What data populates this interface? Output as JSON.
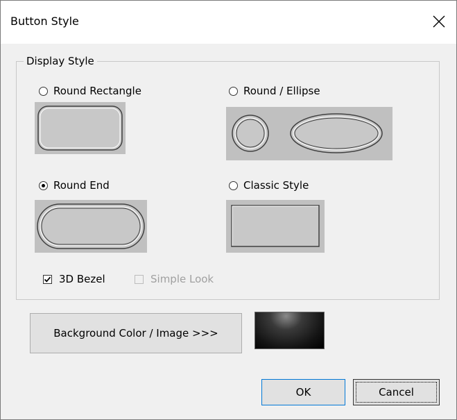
{
  "dialog": {
    "title": "Button Style"
  },
  "group": {
    "label": "Display Style"
  },
  "styles": [
    {
      "label": "Round Rectangle",
      "selected": false
    },
    {
      "label": "Round / Ellipse",
      "selected": false
    },
    {
      "label": "Round End",
      "selected": true
    },
    {
      "label": "Classic Style",
      "selected": false
    }
  ],
  "options": {
    "bezel": {
      "label": "3D Bezel",
      "checked": true,
      "enabled": true
    },
    "simple": {
      "label": "Simple Look",
      "checked": false,
      "enabled": false
    }
  },
  "buttons": {
    "background": "Background Color / Image >>>",
    "ok": "OK",
    "cancel": "Cancel"
  },
  "icons": {
    "close": "close-icon"
  },
  "colors": {
    "preview_bg": "#c0c0c0",
    "face": "#c8c8c8"
  }
}
